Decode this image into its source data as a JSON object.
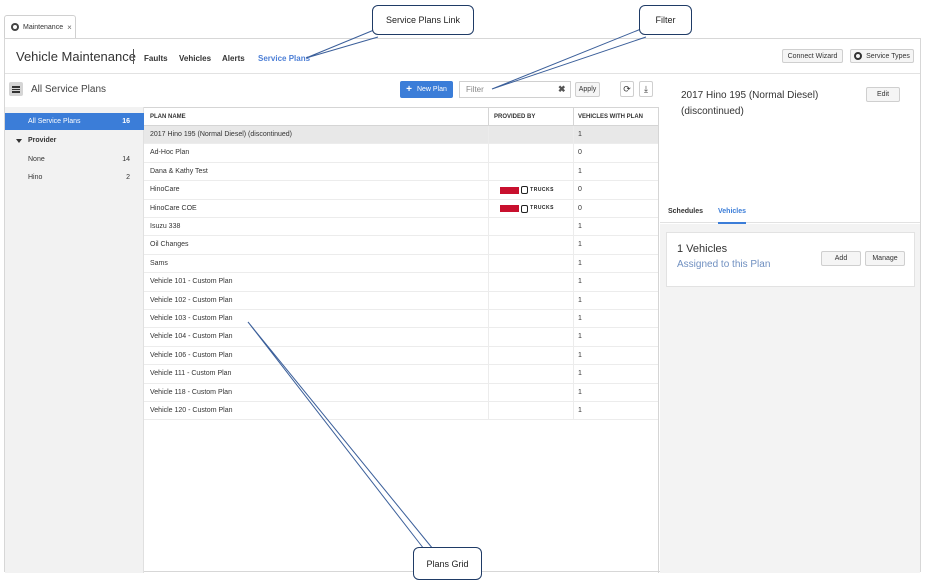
{
  "tab": {
    "label": "Maintenance",
    "close": "×"
  },
  "header": {
    "title": "Vehicle Maintenance",
    "nav": [
      "Faults",
      "Vehicles",
      "Alerts",
      "Service Plans"
    ],
    "connect_wizard": "Connect Wizard",
    "service_types": "Service Types"
  },
  "toolbar": {
    "all_plans_title": "All Service Plans",
    "new_plan": "New Plan",
    "filter_placeholder": "Filter",
    "apply": "Apply"
  },
  "sidebar": {
    "all": {
      "label": "All Service Plans",
      "count": "16"
    },
    "group": "Provider",
    "items": [
      {
        "label": "None",
        "count": "14"
      },
      {
        "label": "Hino",
        "count": "2"
      }
    ]
  },
  "grid": {
    "columns": [
      "PLAN NAME",
      "PROVIDED BY",
      "VEHICLES WITH PLAN"
    ],
    "rows": [
      {
        "name": "2017 Hino 195 (Normal Diesel) (discontinued)",
        "provider": "",
        "count": "1"
      },
      {
        "name": "Ad-Hoc Plan",
        "provider": "",
        "count": "0"
      },
      {
        "name": "Dana & Kathy Test",
        "provider": "",
        "count": "1"
      },
      {
        "name": "HinoCare",
        "provider": "hino",
        "count": "0"
      },
      {
        "name": "HinoCare COE",
        "provider": "hino",
        "count": "0"
      },
      {
        "name": "Isuzu 338",
        "provider": "",
        "count": "1"
      },
      {
        "name": "Oil Changes",
        "provider": "",
        "count": "1"
      },
      {
        "name": "Sams",
        "provider": "",
        "count": "1"
      },
      {
        "name": "Vehicle 101 - Custom Plan",
        "provider": "",
        "count": "1"
      },
      {
        "name": "Vehicle 102 - Custom Plan",
        "provider": "",
        "count": "1"
      },
      {
        "name": "Vehicle 103 - Custom Plan",
        "provider": "",
        "count": "1"
      },
      {
        "name": "Vehicle 104 - Custom Plan",
        "provider": "",
        "count": "1"
      },
      {
        "name": "Vehicle 106 - Custom Plan",
        "provider": "",
        "count": "1"
      },
      {
        "name": "Vehicle 111 - Custom Plan",
        "provider": "",
        "count": "1"
      },
      {
        "name": "Vehicle 118 - Custom Plan",
        "provider": "",
        "count": "1"
      },
      {
        "name": "Vehicle 120 - Custom Plan",
        "provider": "",
        "count": "1"
      }
    ],
    "provider_logo_text": "TRUCKS"
  },
  "detail": {
    "title_line1": "2017 Hino 195 (Normal Diesel)",
    "title_line2": "(discontinued)",
    "edit": "Edit",
    "tabs": [
      "Schedules",
      "Vehicles"
    ],
    "card_title": "1 Vehicles",
    "card_sub": "Assigned to this Plan",
    "add": "Add",
    "manage": "Manage"
  },
  "annotations": {
    "service_plans_link": "Service Plans Link",
    "filter": "Filter",
    "plans_grid": "Plans Grid"
  },
  "colors": {
    "accent": "#3b7dd8",
    "hino_red": "#c8102e"
  },
  "icons": [
    "maintenance-icon",
    "close-icon",
    "gear-icon",
    "menu-icon",
    "plus-icon",
    "clear-icon",
    "refresh-icon",
    "download-icon",
    "caret-down-icon",
    "hino-logo"
  ]
}
